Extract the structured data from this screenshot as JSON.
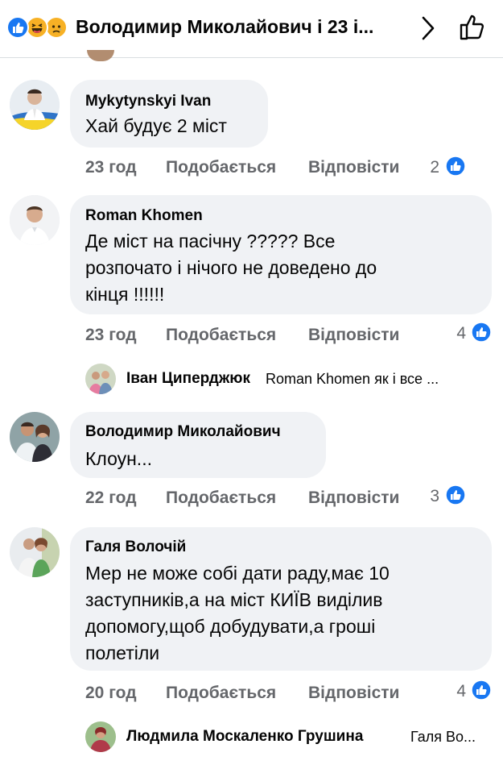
{
  "header": {
    "title": "Володимир Миколайович і 23 і...",
    "reactions": [
      "like-icon",
      "haha-icon",
      "sad-icon"
    ]
  },
  "colors": {
    "accent": "#1877f2",
    "bubble": "#f0f2f5",
    "meta": "#65676b"
  },
  "comments": [
    {
      "author": "Mykytynskyi Ivan",
      "text": "Хай будує 2 міст",
      "time": "23 год",
      "like_label": "Подобається",
      "reply_label": "Відповісти",
      "reactions": "2"
    },
    {
      "author": "Roman Khomen",
      "text": "Де міст на пасічну ?????    Все\nрозпочато і нічого не доведено до\nкінця !!!!!!",
      "time": "23 год",
      "like_label": "Подобається",
      "reply_label": "Відповісти",
      "reactions": "4",
      "reply_preview": {
        "author": "Іван Циперджюк",
        "text": "Roman Khomen як і все ..."
      }
    },
    {
      "author": "Володимир Миколайович",
      "text": "Клоун...",
      "time": "22 год",
      "like_label": "Подобається",
      "reply_label": "Відповісти",
      "reactions": "3"
    },
    {
      "author": "Галя Волочій",
      "text": "Мер не може собі дати раду,має 10\nзаступників,а на міст КИЇВ виділив\nдопомогу,щоб добудувати,а гроші\nполетіли",
      "time": "20 год",
      "like_label": "Подобається",
      "reply_label": "Відповісти",
      "reactions": "4",
      "reply_preview": {
        "author": "Людмила Москаленко Грушина",
        "text": "Галя Во..."
      }
    }
  ]
}
